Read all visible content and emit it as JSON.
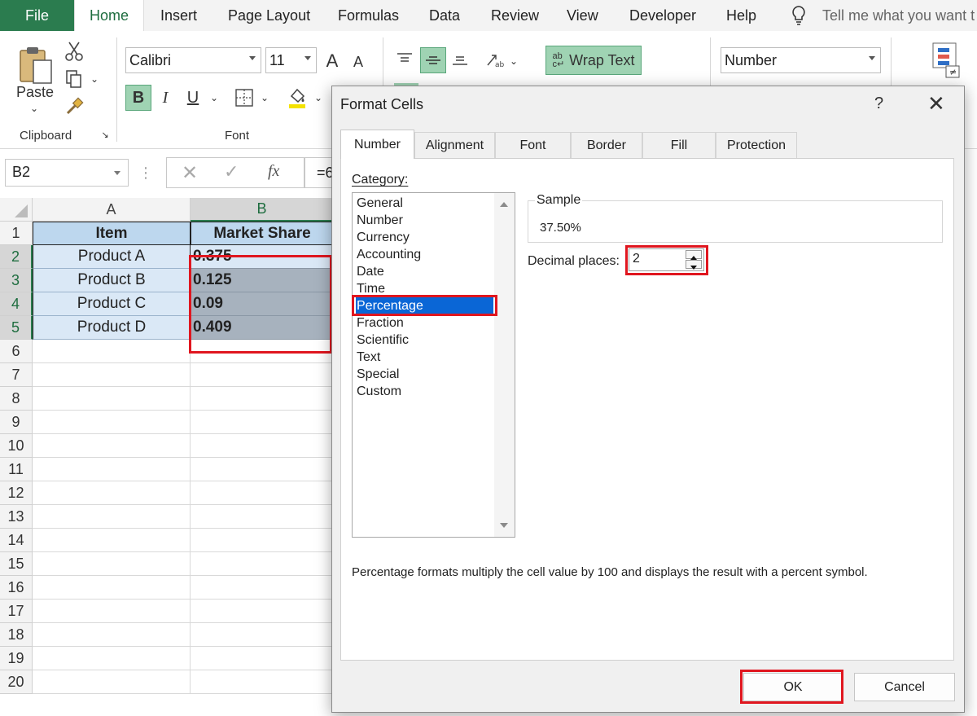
{
  "ribbon_tabs": {
    "file": "File",
    "home": "Home",
    "insert": "Insert",
    "page_layout": "Page Layout",
    "formulas": "Formulas",
    "data": "Data",
    "review": "Review",
    "view": "View",
    "developer": "Developer",
    "help": "Help",
    "tell_me": "Tell me what you want t"
  },
  "ribbon": {
    "paste_label": "Paste",
    "clipboard_label": "Clipboard",
    "font_group_label": "Font",
    "font_name": "Calibri",
    "font_size": "11",
    "bold": "B",
    "italic": "I",
    "underline": "U",
    "wrap_text": "Wrap Text",
    "number_format": "Number",
    "grow_font": "A",
    "shrink_font": "A"
  },
  "formula_bar": {
    "name_box": "B2",
    "fx": "fx",
    "formula_fragment": "=6"
  },
  "sheet": {
    "col_headers": [
      "A",
      "B"
    ],
    "row_numbers": [
      "1",
      "2",
      "3",
      "4",
      "5",
      "6",
      "7",
      "8",
      "9",
      "10",
      "11",
      "12",
      "13",
      "14",
      "15",
      "16",
      "17",
      "18",
      "19",
      "20"
    ],
    "header_item": "Item",
    "header_share": "Market Share",
    "rows": [
      {
        "item": "Product A",
        "share": "0.375"
      },
      {
        "item": "Product B",
        "share": "0.125"
      },
      {
        "item": "Product C",
        "share": "0.09"
      },
      {
        "item": "Product D",
        "share": "0.409"
      }
    ]
  },
  "dialog": {
    "title": "Format Cells",
    "help": "?",
    "close": "✕",
    "tabs": [
      "Number",
      "Alignment",
      "Font",
      "Border",
      "Fill",
      "Protection"
    ],
    "category_label": "Category:",
    "categories": [
      "General",
      "Number",
      "Currency",
      "Accounting",
      "Date",
      "Time",
      "Percentage",
      "Fraction",
      "Scientific",
      "Text",
      "Special",
      "Custom"
    ],
    "selected_category": "Percentage",
    "sample_label": "Sample",
    "sample_value": "37.50%",
    "decimal_label": "Decimal places:",
    "decimal_value": "2",
    "description": "Percentage formats multiply the cell value by 100 and displays the result with a percent symbol.",
    "ok": "OK",
    "cancel": "Cancel"
  },
  "colors": {
    "excel_green": "#2b7c4f",
    "header_fill": "#bdd7ee",
    "data_fill": "#dae8f6",
    "highlight_red": "#e0161f",
    "selection_blue": "#0a66d6"
  }
}
